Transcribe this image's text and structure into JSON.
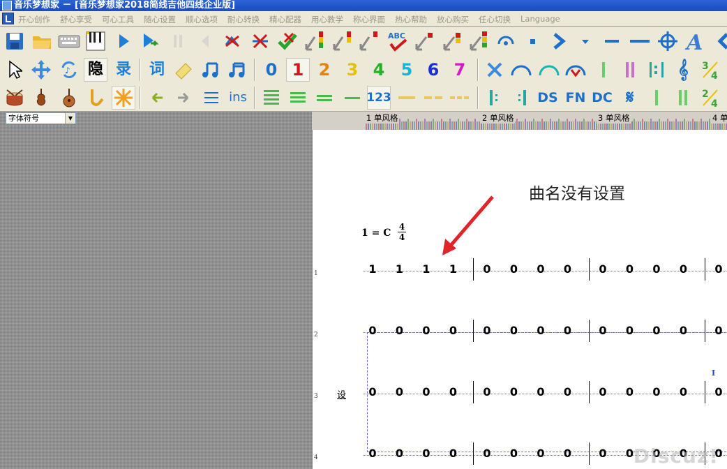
{
  "window": {
    "title": "音乐梦想家 － [音乐梦想家2018简线吉他四线企业版]"
  },
  "menu": {
    "items": [
      "开心创作",
      "舒心享受",
      "可心工具",
      "随心设置",
      "顺心选项",
      "耐心转换",
      "精心配器",
      "用心教学",
      "称心界面",
      "热心帮助",
      "放心购买",
      "任心切换",
      "Language"
    ]
  },
  "toolbar3": {
    "ins_label": "ins",
    "num_label": "123",
    "ds_label": "DS",
    "fn_label": "FN",
    "dc_label": "DC"
  },
  "toolbar2": {
    "hide_label": "隐",
    "record_label": "录",
    "lyric_label": "词",
    "digits": [
      "0",
      "1",
      "2",
      "3",
      "4",
      "5",
      "6",
      "7"
    ]
  },
  "font_select": {
    "value": "字体符号"
  },
  "ruler": {
    "marks": [
      {
        "num": "1",
        "label": "单风格"
      },
      {
        "num": "2",
        "label": "单风格"
      },
      {
        "num": "3",
        "label": "单风格"
      },
      {
        "num": "4",
        "label": "单"
      }
    ]
  },
  "score": {
    "annotation": "曲名没有设置",
    "key": "1 = C",
    "time_top": "4",
    "time_bottom": "4",
    "rows": [
      {
        "num": "1",
        "measures": [
          [
            "1",
            "1",
            "1",
            "1"
          ],
          [
            "0",
            "0",
            "0",
            "0"
          ],
          [
            "0",
            "0",
            "0",
            "0"
          ],
          [
            "0"
          ]
        ]
      },
      {
        "num": "2",
        "measures": [
          [
            "0",
            "0",
            "0",
            "0"
          ],
          [
            "0",
            "0",
            "0",
            "0"
          ],
          [
            "0",
            "0",
            "0",
            "0"
          ],
          [
            "0"
          ]
        ]
      },
      {
        "num": "3",
        "measures": [
          [
            "0",
            "0",
            "0",
            "0"
          ],
          [
            "0",
            "0",
            "0",
            "0"
          ],
          [
            "0",
            "0",
            "0",
            "0"
          ],
          [
            "0"
          ]
        ]
      },
      {
        "num": "4",
        "measures": [
          [
            "0",
            "0",
            "0",
            "0"
          ],
          [
            "0",
            "0",
            "0",
            "0"
          ],
          [
            "0",
            "0",
            "0",
            "0"
          ],
          [
            "0"
          ]
        ]
      }
    ],
    "side_label": "设",
    "cursor": "I"
  },
  "watermark": "Discuz!",
  "colors": {
    "digit_colors": [
      "#1e6fc9",
      "#d01818",
      "#e8820c",
      "#e6c100",
      "#26b026",
      "#16b6d8",
      "#1a2ed8",
      "#d31ac8"
    ],
    "accent": "#2c63d6"
  }
}
